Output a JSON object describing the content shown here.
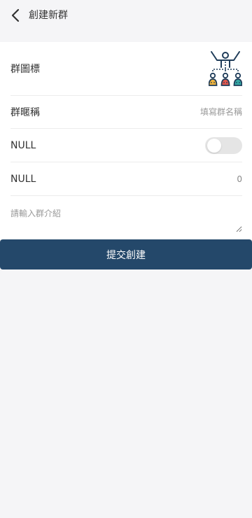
{
  "header": {
    "back_icon": "chevron-left-icon",
    "title": "創建新群"
  },
  "form": {
    "icon_row": {
      "label": "群圖標",
      "icon": "group-people-icon"
    },
    "name_row": {
      "label": "群暱稱",
      "placeholder": "填寫群名稱",
      "value": ""
    },
    "toggle_row": {
      "label": "NULL",
      "enabled": false
    },
    "count_row": {
      "label": "NULL",
      "value": "0"
    },
    "intro": {
      "placeholder": "請輸入群介紹",
      "value": ""
    }
  },
  "submit": {
    "label": "提交創建"
  },
  "colors": {
    "background": "#f5f5f7",
    "card": "#ffffff",
    "primary_button": "#24486a",
    "divider": "#ececec",
    "icon_stroke": "#1f3c59",
    "icon_yellow": "#f2b53d",
    "icon_red": "#e2574c",
    "icon_teal": "#34a8a4"
  }
}
